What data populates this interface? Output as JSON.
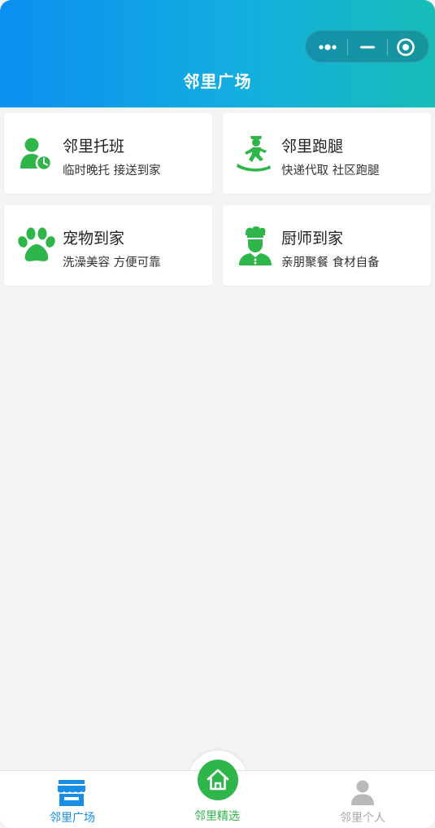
{
  "header": {
    "title": "邻里广场",
    "capsule_icons": [
      "more-dots-icon",
      "minimize-icon",
      "close-target-icon"
    ]
  },
  "services": [
    {
      "title": "邻里托班",
      "subtitle": "临时晚托 接送到家",
      "icon": "child-clock-icon"
    },
    {
      "title": "邻里跑腿",
      "subtitle": "快递代取 社区跑腿",
      "icon": "runner-icon"
    },
    {
      "title": "宠物到家",
      "subtitle": "洗澡美容 方便可靠",
      "icon": "paw-icon"
    },
    {
      "title": "厨师到家",
      "subtitle": "亲朋聚餐 食材自备",
      "icon": "chef-icon"
    }
  ],
  "tabbar": {
    "items": [
      {
        "label": "邻里广场",
        "icon": "store-icon",
        "active": true
      },
      {
        "label": "邻里精选",
        "icon": "home-icon",
        "active": false
      },
      {
        "label": "邻里个人",
        "icon": "person-icon",
        "active": false
      }
    ]
  },
  "colors": {
    "header_start": "#0b8ff0",
    "header_end": "#16bdb7",
    "icon_green": "#2fb64a",
    "tab_active": "#1a8de6",
    "tab_inactive": "#a8a8a8",
    "background": "#f4f4f4"
  }
}
